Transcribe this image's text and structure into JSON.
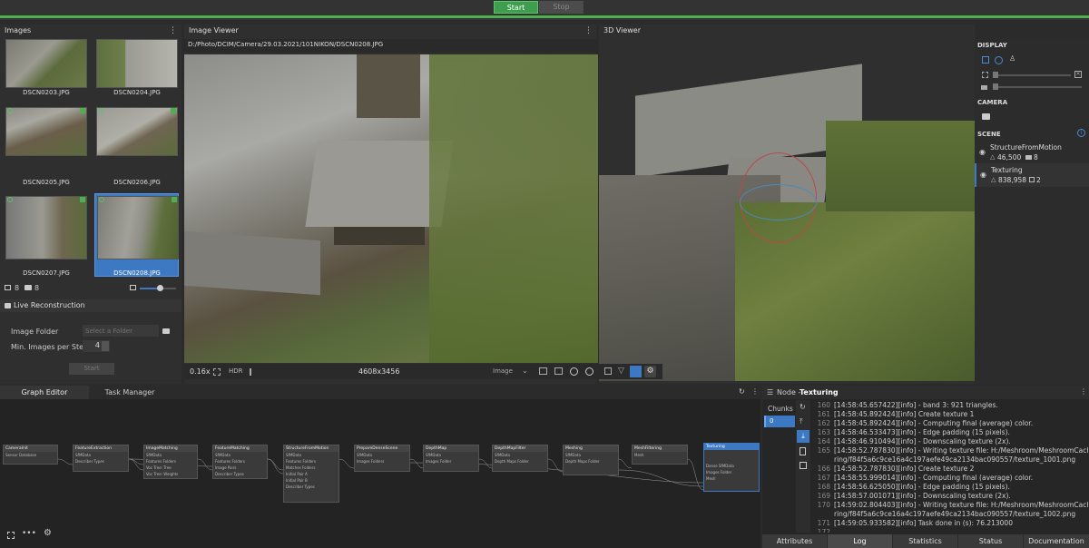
{
  "toolbar": {
    "start_label": "Start",
    "stop_label": "Stop"
  },
  "images_panel": {
    "title": "Images",
    "thumbnails": [
      {
        "label": "DSCN0203.JPG"
      },
      {
        "label": "DSCN0204.JPG"
      },
      {
        "label": "DSCN0205.JPG"
      },
      {
        "label": "DSCN0206.JPG"
      },
      {
        "label": "DSCN0207.JPG"
      },
      {
        "label": "DSCN0208.JPG",
        "selected": true
      }
    ],
    "image_count": "8",
    "camera_count": "8",
    "live_reconstruction_label": "Live Reconstruction",
    "image_folder_label": "Image Folder",
    "image_folder_placeholder": "Select a Folder",
    "min_images_label": "Min. Images per Step",
    "min_images_value": "4",
    "start_label": "Start"
  },
  "image_viewer": {
    "title": "Image Viewer",
    "path": "D:/Photo/DCIM/Camera/29.03.2021/101NIKON/DSCN0208.JPG",
    "zoom": "0.16x",
    "hdr_label": "HDR",
    "resolution": "4608x3456",
    "mode_label": "Image"
  },
  "viewer3d": {
    "title": "3D Viewer",
    "display_label": "DISPLAY",
    "camera_label": "CAMERA",
    "scene_label": "SCENE",
    "scene_items": [
      {
        "name": "StructureFromMotion",
        "points": "46,500",
        "cameras": "8"
      },
      {
        "name": "Texturing",
        "points": "838,958",
        "cameras": "2"
      }
    ]
  },
  "graph_editor": {
    "tab_graph": "Graph Editor",
    "tab_task": "Task Manager",
    "nodes": [
      {
        "name": "CameraInit",
        "ports": [
          "Sensor Database"
        ]
      },
      {
        "name": "FeatureExtraction",
        "ports": [
          "SfMData",
          "Describer Types"
        ]
      },
      {
        "name": "ImageMatching",
        "ports": [
          "SfMData",
          "Features Folders",
          "Voc Tree: Tree",
          "Voc Tree: Weights"
        ]
      },
      {
        "name": "FeatureMatching",
        "ports": [
          "SfMData",
          "Features Folders",
          "Image Pairs",
          "Describer Types"
        ]
      },
      {
        "name": "StructureFromMotion",
        "ports": [
          "SfMData",
          "Features Folders",
          "Matches Folders",
          "Initial Pair A",
          "Initial Pair B",
          "Describer Types"
        ]
      },
      {
        "name": "PrepareDenseScene",
        "ports": [
          "SfMData",
          "Images Folders"
        ]
      },
      {
        "name": "DepthMap",
        "ports": [
          "SfMData",
          "Images Folder"
        ]
      },
      {
        "name": "DepthMapFilter",
        "ports": [
          "SfMData",
          "Depth Maps Folder"
        ]
      },
      {
        "name": "Meshing",
        "ports": [
          "SfMData",
          "Depth Maps Folder"
        ]
      },
      {
        "name": "MeshFiltering",
        "ports": [
          "Mesh"
        ]
      },
      {
        "name": "Texturing",
        "ports": [
          "Dense SfMData",
          "Images Folder",
          "Mesh"
        ]
      }
    ]
  },
  "node_panel": {
    "title_prefix": "Node - ",
    "title_node": "Texturing",
    "chunks_label": "Chunks",
    "chunk_value": "0",
    "log": [
      {
        "n": "160",
        "t": "[14:58:45.657422][info]      - band 3: 921 triangles."
      },
      {
        "n": "161",
        "t": "[14:58:45.892424][info] Create texture 1"
      },
      {
        "n": "162",
        "t": "[14:58:45.892424][info]   - Computing final (average) color."
      },
      {
        "n": "163",
        "t": "[14:58:46.533473][info]   - Edge padding (15 pixels)."
      },
      {
        "n": "164",
        "t": "[14:58:46.910494][info]   - Downscaling texture (2x)."
      },
      {
        "n": "165",
        "t": "[14:58:52.787830][info]   - Writing texture file: H:/Meshroom/MeshroomCache/Textu"
      },
      {
        "n": "",
        "t": "ring/f84f5a6c9ce16a4c197aefe49ca2134bac090557/texture_1001.png"
      },
      {
        "n": "166",
        "t": "[14:58:52.787830][info] Create texture 2"
      },
      {
        "n": "167",
        "t": "[14:58:55.999014][info]   - Computing final (average) color."
      },
      {
        "n": "168",
        "t": "[14:58:56.625050][info]   - Edge padding (15 pixels)."
      },
      {
        "n": "169",
        "t": "[14:58:57.001071][info]   - Downscaling texture (2x)."
      },
      {
        "n": "170",
        "t": "[14:59:02.804403][info]   - Writing texture file: H:/Meshroom/MeshroomCache/Textu"
      },
      {
        "n": "",
        "t": "ring/f84f5a6c9ce16a4c197aefe49ca2134bac090557/texture_1002.png"
      },
      {
        "n": "171",
        "t": "[14:59:05.933582][info] Task done in (s): 76.213000"
      },
      {
        "n": "172",
        "t": ""
      }
    ],
    "tabs": [
      "Attributes",
      "Log",
      "Statistics",
      "Status",
      "Documentation"
    ]
  }
}
